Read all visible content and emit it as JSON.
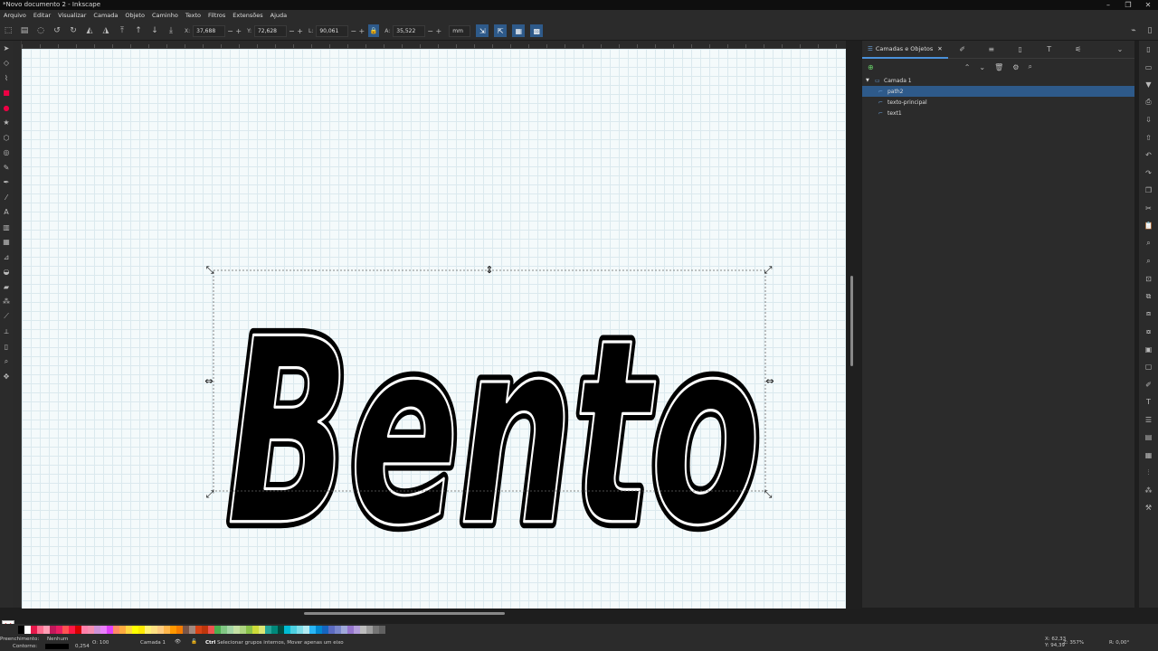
{
  "window": {
    "title": "*Novo documento 2 - Inkscape"
  },
  "menu": [
    "Arquivo",
    "Editar",
    "Visualizar",
    "Camada",
    "Objeto",
    "Caminho",
    "Texto",
    "Filtros",
    "Extensões",
    "Ajuda"
  ],
  "toolbar": {
    "x_label": "X:",
    "x_value": "37,688",
    "y_label": "Y:",
    "y_value": "72,628",
    "w_label": "L:",
    "w_value": "90,061",
    "h_label": "A:",
    "h_value": "35,522",
    "unit": "mm"
  },
  "canvas": {
    "text": "Bento"
  },
  "dock": {
    "tab_label": "Camadas e Objetos",
    "layers": [
      {
        "name": "Camada 1",
        "level": 0,
        "selected": false
      },
      {
        "name": "path2",
        "level": 1,
        "selected": true
      },
      {
        "name": "texto-principal",
        "level": 1,
        "selected": false
      },
      {
        "name": "text1",
        "level": 1,
        "selected": false
      }
    ]
  },
  "palette": [
    "#000000",
    "#ffffff",
    "#e6194b",
    "#ff6f91",
    "#ff9eb5",
    "#c2185b",
    "#e91e63",
    "#ff5252",
    "#ff1744",
    "#d50000",
    "#ff80ab",
    "#f48fb1",
    "#ce93d8",
    "#ea80fc",
    "#e040fb",
    "#ff8a65",
    "#ffab40",
    "#ffd740",
    "#ffff00",
    "#ffea00",
    "#fff176",
    "#ffe082",
    "#ffcc80",
    "#ffb74d",
    "#ff9800",
    "#f57c00",
    "#795548",
    "#a1887f",
    "#d84315",
    "#bf360c",
    "#ef5350",
    "#4caf50",
    "#81c784",
    "#a5d6a7",
    "#c5e1a5",
    "#aed581",
    "#8bc34a",
    "#cddc39",
    "#dce775",
    "#26a69a",
    "#00897b",
    "#004d40",
    "#00bcd4",
    "#4dd0e1",
    "#80deea",
    "#b2ebf2",
    "#29b6f6",
    "#0288d1",
    "#1565c0",
    "#5c6bc0",
    "#7986cb",
    "#9fa8da",
    "#9575cd",
    "#b39ddb",
    "#bdbdbd",
    "#9e9e9e",
    "#757575",
    "#616161"
  ],
  "status": {
    "fill_label": "Preenchimento:",
    "fill_value": "Nenhum",
    "stroke_label": "Contorno:",
    "stroke_width": "0,254",
    "opacity_label": "O:",
    "opacity_value": "100",
    "layer": "Camada 1",
    "message_key": "Ctrl",
    "message": "Selecionar grupos internos, Mover apenas um eixo",
    "x_coord": "X: 62,33",
    "y_coord": "Y: 94,39",
    "zoom": "Z: 357%",
    "rotation": "R: 0,00°"
  }
}
